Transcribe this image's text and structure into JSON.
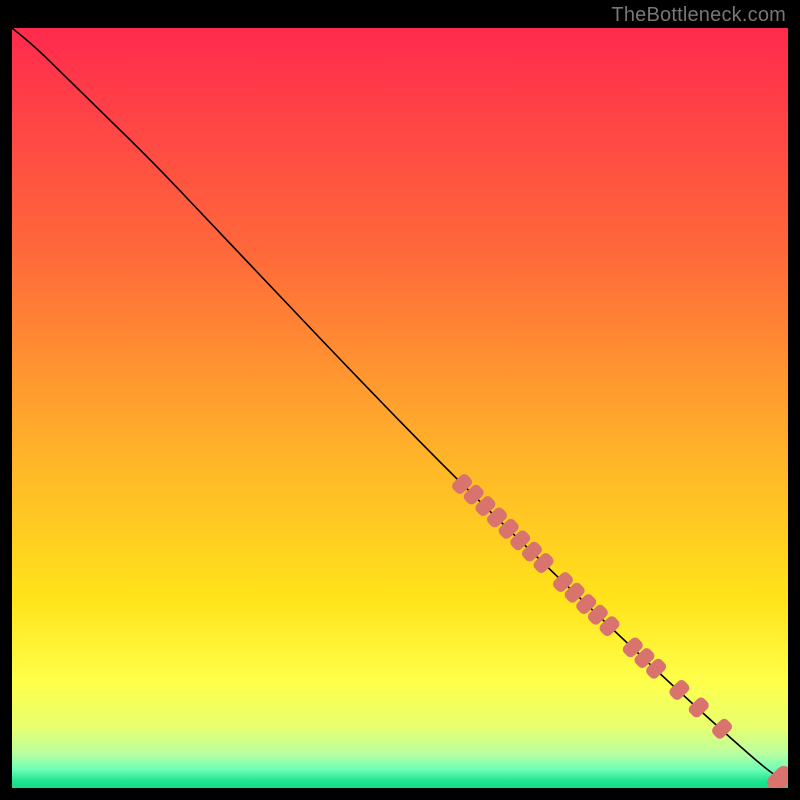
{
  "watermark": "TheBottleneck.com",
  "chart_data": {
    "type": "line",
    "title": "",
    "xlabel": "",
    "ylabel": "",
    "xlim": [
      0,
      100
    ],
    "ylim": [
      0,
      100
    ],
    "grid": false,
    "background_gradient": {
      "stops": [
        {
          "offset": 0.0,
          "color": "#ff2a4d"
        },
        {
          "offset": 0.3,
          "color": "#ff6a3a"
        },
        {
          "offset": 0.55,
          "color": "#ffb02a"
        },
        {
          "offset": 0.75,
          "color": "#ffe31a"
        },
        {
          "offset": 0.86,
          "color": "#ffff4a"
        },
        {
          "offset": 0.92,
          "color": "#e8ff70"
        },
        {
          "offset": 0.955,
          "color": "#b8ffa0"
        },
        {
          "offset": 0.975,
          "color": "#70ffb8"
        },
        {
          "offset": 0.99,
          "color": "#22e593"
        },
        {
          "offset": 1.0,
          "color": "#18d983"
        }
      ]
    },
    "curve": {
      "color": "#000000",
      "width": 1.6,
      "points": [
        {
          "x": 0.0,
          "y": 100.0
        },
        {
          "x": 3.0,
          "y": 97.5
        },
        {
          "x": 7.0,
          "y": 93.5
        },
        {
          "x": 12.0,
          "y": 88.5
        },
        {
          "x": 18.0,
          "y": 82.5
        },
        {
          "x": 25.0,
          "y": 75.0
        },
        {
          "x": 35.0,
          "y": 64.2
        },
        {
          "x": 45.0,
          "y": 53.5
        },
        {
          "x": 55.0,
          "y": 43.0
        },
        {
          "x": 65.0,
          "y": 33.0
        },
        {
          "x": 75.0,
          "y": 23.2
        },
        {
          "x": 85.0,
          "y": 13.6
        },
        {
          "x": 93.0,
          "y": 6.2
        },
        {
          "x": 98.0,
          "y": 1.8
        },
        {
          "x": 100.0,
          "y": 0.8
        }
      ]
    },
    "marker_style": {
      "type": "squircle",
      "size_x": 20,
      "size_y": 14,
      "corner_radius": 5,
      "angle_deg": -44,
      "fill": "#d9736e",
      "stroke": "none"
    },
    "markers_along_curve": [
      {
        "x": 58.0,
        "y": 40.0
      },
      {
        "x": 59.5,
        "y": 38.6
      },
      {
        "x": 61.0,
        "y": 37.1
      },
      {
        "x": 62.5,
        "y": 35.6
      },
      {
        "x": 64.0,
        "y": 34.1
      },
      {
        "x": 65.5,
        "y": 32.6
      },
      {
        "x": 67.0,
        "y": 31.1
      },
      {
        "x": 68.5,
        "y": 29.6
      },
      {
        "x": 71.0,
        "y": 27.1
      },
      {
        "x": 72.5,
        "y": 25.7
      },
      {
        "x": 74.0,
        "y": 24.2
      },
      {
        "x": 75.5,
        "y": 22.8
      },
      {
        "x": 77.0,
        "y": 21.3
      },
      {
        "x": 80.0,
        "y": 18.5
      },
      {
        "x": 81.5,
        "y": 17.1
      },
      {
        "x": 83.0,
        "y": 15.7
      },
      {
        "x": 86.0,
        "y": 12.9
      },
      {
        "x": 88.5,
        "y": 10.6
      },
      {
        "x": 91.5,
        "y": 7.8
      }
    ],
    "end_marker": {
      "x": 99.0,
      "y": 1.2
    }
  }
}
